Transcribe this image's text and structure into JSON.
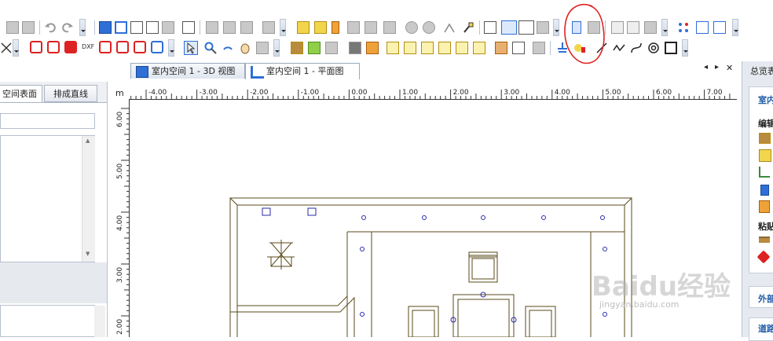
{
  "tabs": [
    {
      "label": "室内空间 1 - 3D 视图"
    },
    {
      "label": "室内空间 1 - 平面图"
    }
  ],
  "tab_controls": {
    "prev": "◂",
    "next": "▸",
    "close": "✕"
  },
  "left_panel": {
    "tabs": [
      "空间表面",
      "排成直线"
    ],
    "scroll_up": "▲",
    "scroll_down": "▼"
  },
  "ruler": {
    "unit": "m",
    "top_ticks": [
      "-4.00",
      "-3.00",
      "-2.00",
      "-1.00",
      "0.00",
      "1.00",
      "2.00",
      "3.00",
      "4.00",
      "5.00",
      "6.00",
      "7.00"
    ],
    "left_ticks": [
      "6.00",
      "5.00",
      "4.00",
      "3.00",
      "2.00"
    ]
  },
  "right_panel": {
    "title": "总览表",
    "section1_title": "室内",
    "edit_label": "编辑",
    "paste_label": "粘贴",
    "section2_title": "外部",
    "section3_title": "道路"
  },
  "watermark": {
    "brand": "Baidu经验",
    "url": "jingyan.baidu.com"
  },
  "colors": {
    "accent": "#2f6fd6",
    "plan_line": "#5a4a1a",
    "annotation": "#dd2222",
    "panel_title": "#1f5aa6"
  }
}
